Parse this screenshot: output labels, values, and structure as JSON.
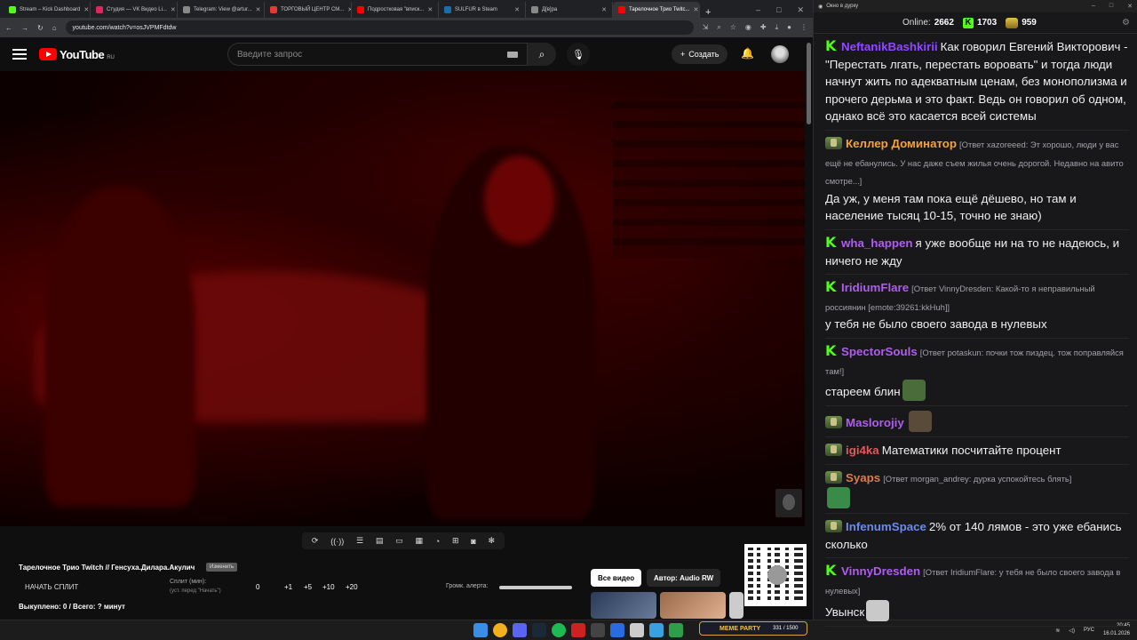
{
  "browser": {
    "tabs": [
      {
        "label": "Stream – Kick Dashboard",
        "color": "#53fc18",
        "active": false
      },
      {
        "label": "Студия — VK Видео Li...",
        "color": "#e0245e",
        "active": false
      },
      {
        "label": "Telegram: View @artur...",
        "color": "#888888",
        "active": false
      },
      {
        "label": "ТОРГОВЫЙ ЦЕНТР СМ...",
        "color": "#e53935",
        "active": false
      },
      {
        "label": "Подростковая \"вписк...",
        "color": "#ff0000",
        "active": false
      },
      {
        "label": "SULFUR в Steam",
        "color": "#1b6fa8",
        "active": false
      },
      {
        "label": "Д[в]ра",
        "color": "#888888",
        "active": false
      },
      {
        "label": "Тарелочное Трио Twitc...",
        "color": "#ff0000",
        "active": true
      }
    ],
    "url": "youtube.com/watch?v=osJVPMFdtdw"
  },
  "youtube": {
    "logo_text": "YouTube",
    "region": "RU",
    "search_placeholder": "Введите запрос",
    "create_label": "Создать"
  },
  "controls": {
    "icons": [
      "loop-icon",
      "broadcast-icon",
      "eye-list-icon",
      "clapper-icon",
      "screen-icon",
      "film-icon",
      "speed-icon",
      "add-clip-icon",
      "camera-icon",
      "settings-icon"
    ]
  },
  "split": {
    "title": "Тарелочное Трио Twitch // Генсуха.Дилара.Акулич",
    "change_label": "Изменить",
    "start_label": "НАЧАТЬ СПЛИТ",
    "minutes_label": "Сплит (мин):",
    "minutes_hint": "(уст. перед \"Начать\")",
    "minutes_value": "0",
    "increments": [
      "+1",
      "+5",
      "+10",
      "+20"
    ],
    "bought": "Выкуплено: 0 / Всего: ? минут",
    "alert_volume_label": "Громк. алерта:",
    "alert_volume": 1.0
  },
  "video_chips": {
    "all": "Все видео",
    "author": "Автор: Audio RW"
  },
  "meme_party": {
    "label": "MEME PARTY",
    "counter": "331 / 1500"
  },
  "taskbar": {
    "lang": "РУС",
    "time": "20:45",
    "date": "16.01.2026"
  },
  "chat": {
    "window_title": "Окно в дурку",
    "online_label": "Online:",
    "online_count": "2662",
    "kick_count": "1703",
    "twitch_count": "959",
    "messages": [
      {
        "badge": "k",
        "user": "NeftanikBashkirii",
        "color": "#9147ff",
        "reply": "",
        "text": "Как говорил Евгений Викторович - \"Перестать лгать, перестать воровать\" и тогда люди начнут жить по адекватным ценам, без монополизма и прочего дерьма и это факт. Ведь он говорил об одном, однако всё это касается всей системы"
      },
      {
        "badge": "t",
        "user": "Келлер Доминатор",
        "color": "#f2a33a",
        "reply": "[Ответ xazoreeed: Эт хорошо, люди у вас ещё не ебанулись. У нас даже съем жилья очень дорогой. Недавно на авито смотре...]",
        "text": "Да уж, у меня там пока ещё дёшево, но там и население тысяц 10-15, точно не знаю)"
      },
      {
        "badge": "k",
        "user": "wha_happen",
        "color": "#b05cf0",
        "reply": "",
        "text": "я уже вообще ни на то не надеюсь, и ничего не жду"
      },
      {
        "badge": "k",
        "user": "IridiumFlare",
        "color": "#b05cf0",
        "reply": "[Ответ VinnyDresden: Какой-то я неправильный россиянин [emote:39261:kkHuh]]",
        "text": "у тебя не было своего завода в нулевых"
      },
      {
        "badge": "k",
        "user": "SpectorSouls",
        "color": "#b05cf0",
        "reply": "[Ответ potaskun: почки тож пиздец. тож поправляйся там!]",
        "text": "стареем блин",
        "emote": "#4a6b3a"
      },
      {
        "badge": "t",
        "user": "Maslorojiy",
        "color": "#b05cf0",
        "reply": "",
        "text": "",
        "emote": "#5a4a3a"
      },
      {
        "badge": "t",
        "user": "igi4ka",
        "color": "#e05a5a",
        "reply": "",
        "text": "Математики посчитайте процент"
      },
      {
        "badge": "t",
        "user": "Syaps",
        "color": "#e07a4a",
        "reply": "[Ответ morgan_andrey: дурка успокойтесь блять]",
        "text": "",
        "emote": "#3a8a4a"
      },
      {
        "badge": "t",
        "user": "InfenumSpace",
        "color": "#6a8af0",
        "reply": "",
        "text": "2% от 140 лямов - это уже ебанись сколько"
      },
      {
        "badge": "k",
        "user": "VinnyDresden",
        "color": "#b05cf0",
        "reply": "[Ответ IridiumFlare: у тебя не было своего завода в нулевых]",
        "text": "Увынск",
        "emote": "#c9c9c9"
      }
    ]
  }
}
